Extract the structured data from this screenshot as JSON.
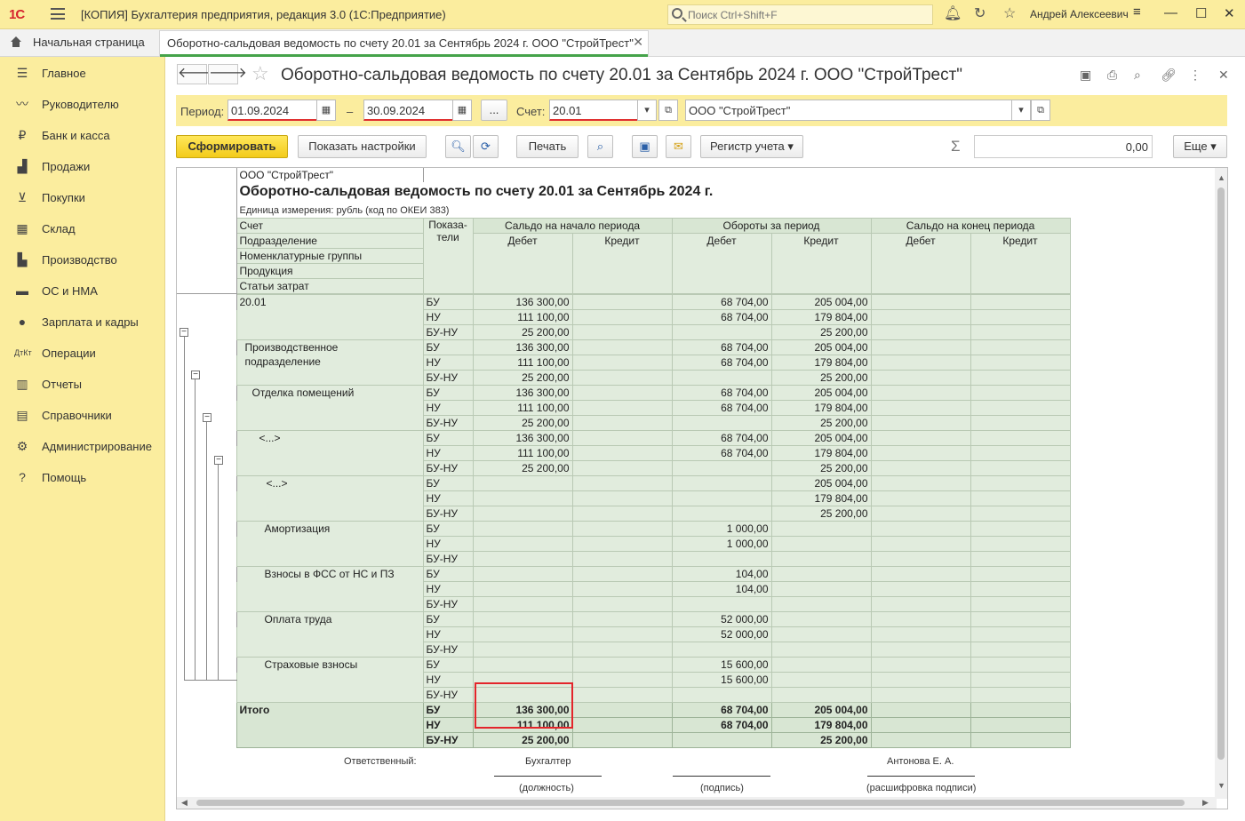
{
  "titlebar": {
    "logo": "1С",
    "app_title": "[КОПИЯ] Бухгалтерия предприятия, редакция 3.0  (1С:Предприятие)",
    "search_placeholder": "Поиск Ctrl+Shift+F",
    "user_name": "Андрей Алексеевич"
  },
  "tabs": {
    "home": "Начальная страница",
    "doc": "Оборотно-сальдовая ведомость по счету 20.01 за Сентябрь 2024 г. ООО \"СтройТрест\""
  },
  "sidebar": {
    "items": [
      {
        "label": "Главное",
        "icon": "menu-lines-icon"
      },
      {
        "label": "Руководителю",
        "icon": "trend-icon"
      },
      {
        "label": "Банк и касса",
        "icon": "ruble-coin-icon"
      },
      {
        "label": "Продажи",
        "icon": "shopping-bag-icon"
      },
      {
        "label": "Покупки",
        "icon": "cart-icon"
      },
      {
        "label": "Склад",
        "icon": "warehouse-icon"
      },
      {
        "label": "Производство",
        "icon": "factory-icon"
      },
      {
        "label": "ОС и НМА",
        "icon": "truck-icon"
      },
      {
        "label": "Зарплата и кадры",
        "icon": "person-icon"
      },
      {
        "label": "Операции",
        "icon": "dt-kt-icon"
      },
      {
        "label": "Отчеты",
        "icon": "bar-chart-icon"
      },
      {
        "label": "Справочники",
        "icon": "book-icon"
      },
      {
        "label": "Администрирование",
        "icon": "gear-icon"
      },
      {
        "label": "Помощь",
        "icon": "question-icon"
      }
    ]
  },
  "form": {
    "title": "Оборотно-сальдовая ведомость по счету 20.01 за Сентябрь 2024 г. ООО \"СтройТрест\""
  },
  "params": {
    "period_label": "Период:",
    "date_from": "01.09.2024",
    "dash": "–",
    "date_to": "30.09.2024",
    "dots": "...",
    "account_label": "Счет:",
    "account": "20.01",
    "org": "ООО \"СтройТрест\""
  },
  "commands": {
    "generate": "Сформировать",
    "show_settings": "Показать настройки",
    "print": "Печать",
    "register": "Регистр учета",
    "sum_symbol": "Σ",
    "sum_value": "0,00",
    "more": "Еще"
  },
  "report": {
    "org": "ООО \"СтройТрест\"",
    "title": "Оборотно-сальдовая ведомость по счету 20.01 за Сентябрь 2024 г.",
    "unit": "Единица измерения: рубль (код по ОКЕИ 383)",
    "head": {
      "left_rows": [
        "Счет",
        "Подразделение",
        "Номенклатурные группы",
        "Продукция",
        "Статьи затрат"
      ],
      "indicators": "Показа-\nтели",
      "start_balance": "Сальдо на начало периода",
      "turnover": "Обороты за период",
      "end_balance": "Сальдо на конец периода",
      "debit": "Дебет",
      "credit": "Кредит"
    },
    "indicators": [
      "БУ",
      "НУ",
      "БУ-НУ"
    ],
    "groups": [
      {
        "label": "20.01",
        "level": 0,
        "rows": [
          [
            "136 300,00",
            "",
            "68 704,00",
            "205 004,00",
            "",
            ""
          ],
          [
            "111 100,00",
            "",
            "68 704,00",
            "179 804,00",
            "",
            ""
          ],
          [
            "25 200,00",
            "",
            "",
            "25 200,00",
            "",
            ""
          ]
        ]
      },
      {
        "label": "Производственное\nподразделение",
        "level": 1,
        "rows": [
          [
            "136 300,00",
            "",
            "68 704,00",
            "205 004,00",
            "",
            ""
          ],
          [
            "111 100,00",
            "",
            "68 704,00",
            "179 804,00",
            "",
            ""
          ],
          [
            "25 200,00",
            "",
            "",
            "25 200,00",
            "",
            ""
          ]
        ]
      },
      {
        "label": "Отделка помещений",
        "level": 2,
        "rows": [
          [
            "136 300,00",
            "",
            "68 704,00",
            "205 004,00",
            "",
            ""
          ],
          [
            "111 100,00",
            "",
            "68 704,00",
            "179 804,00",
            "",
            ""
          ],
          [
            "25 200,00",
            "",
            "",
            "25 200,00",
            "",
            ""
          ]
        ]
      },
      {
        "label": "<...>",
        "level": 3,
        "rows": [
          [
            "136 300,00",
            "",
            "68 704,00",
            "205 004,00",
            "",
            ""
          ],
          [
            "111 100,00",
            "",
            "68 704,00",
            "179 804,00",
            "",
            ""
          ],
          [
            "25 200,00",
            "",
            "",
            "25 200,00",
            "",
            ""
          ]
        ]
      },
      {
        "label": "<...>",
        "level": 4,
        "rows": [
          [
            "",
            "",
            "",
            "205 004,00",
            "",
            ""
          ],
          [
            "",
            "",
            "",
            "179 804,00",
            "",
            ""
          ],
          [
            "",
            "",
            "",
            "25 200,00",
            "",
            ""
          ]
        ]
      },
      {
        "label": "Амортизация",
        "level": 5,
        "rows": [
          [
            "",
            "",
            "1 000,00",
            "",
            "",
            ""
          ],
          [
            "",
            "",
            "1 000,00",
            "",
            "",
            ""
          ],
          [
            "",
            "",
            "",
            "",
            "",
            ""
          ]
        ]
      },
      {
        "label": "Взносы в ФСС от НС и ПЗ",
        "level": 5,
        "rows": [
          [
            "",
            "",
            "104,00",
            "",
            "",
            ""
          ],
          [
            "",
            "",
            "104,00",
            "",
            "",
            ""
          ],
          [
            "",
            "",
            "",
            "",
            "",
            ""
          ]
        ]
      },
      {
        "label": "Оплата труда",
        "level": 5,
        "rows": [
          [
            "",
            "",
            "52 000,00",
            "",
            "",
            ""
          ],
          [
            "",
            "",
            "52 000,00",
            "",
            "",
            ""
          ],
          [
            "",
            "",
            "",
            "",
            "",
            ""
          ]
        ]
      },
      {
        "label": "Страховые взносы",
        "level": 5,
        "rows": [
          [
            "",
            "",
            "15 600,00",
            "",
            "",
            ""
          ],
          [
            "",
            "",
            "15 600,00",
            "",
            "",
            ""
          ],
          [
            "",
            "",
            "",
            "",
            "",
            ""
          ]
        ]
      }
    ],
    "total": {
      "label": "Итого",
      "rows": [
        [
          "136 300,00",
          "",
          "68 704,00",
          "205 004,00",
          "",
          ""
        ],
        [
          "111 100,00",
          "",
          "68 704,00",
          "179 804,00",
          "",
          ""
        ],
        [
          "25 200,00",
          "",
          "",
          "25 200,00",
          "",
          ""
        ]
      ]
    },
    "signature": {
      "responsible": "Ответственный:",
      "position_value": "Бухгалтер",
      "name_value": "Антонова Е. А.",
      "position_caption": "(должность)",
      "sign_caption": "(подпись)",
      "name_caption": "(расшифровка подписи)"
    }
  },
  "colors": {
    "header_yellow": "#fbed9e",
    "table_green": "#e1ecdd",
    "highlight_red": "#e3252b"
  }
}
